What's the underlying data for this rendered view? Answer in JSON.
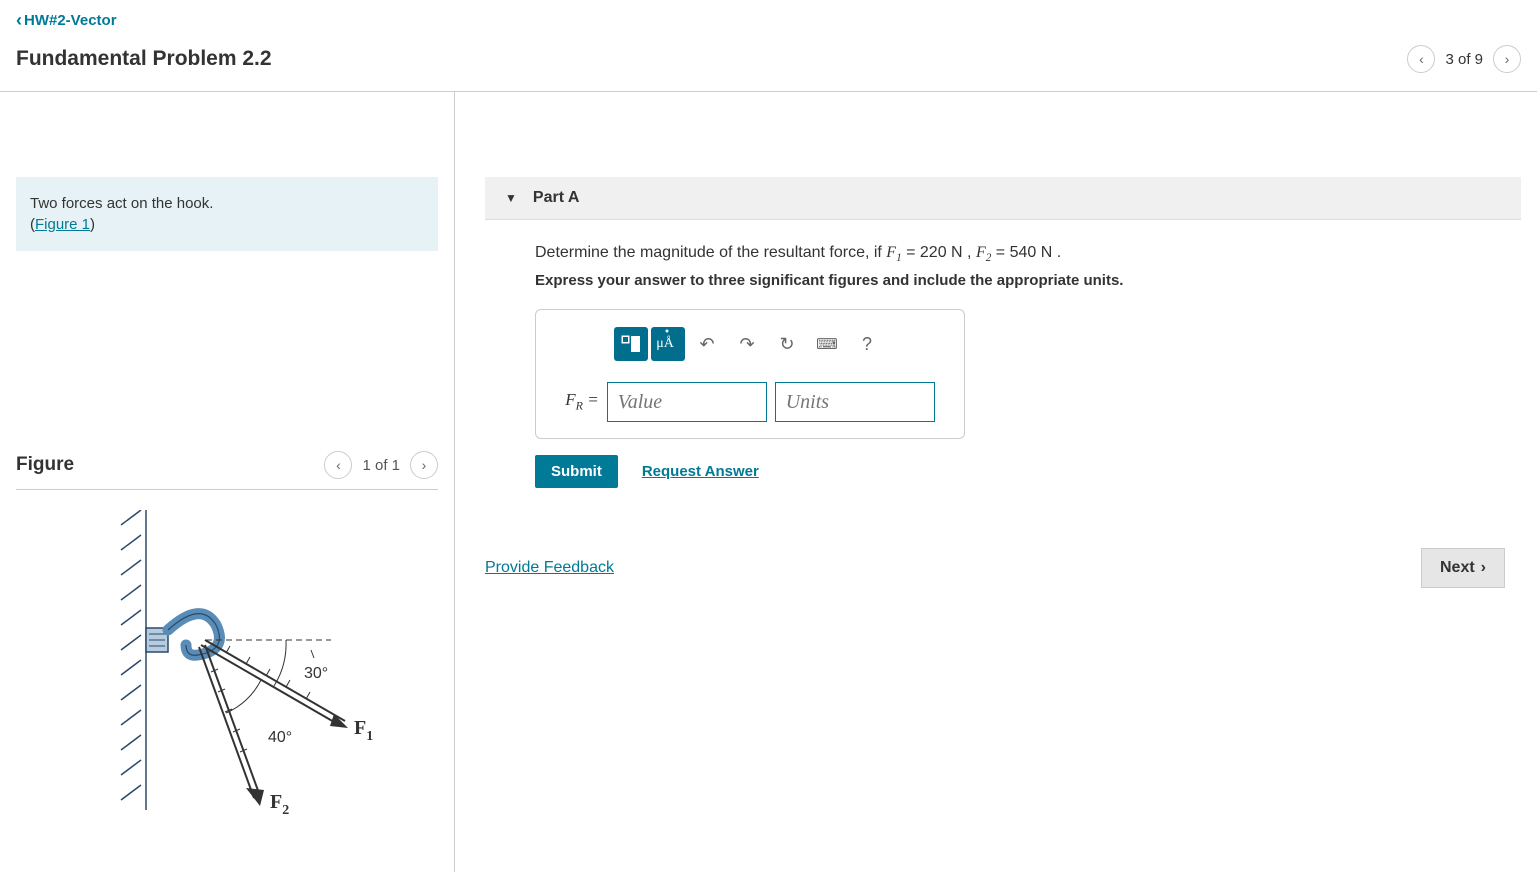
{
  "breadcrumb": "HW#2-Vector",
  "problem_title": "Fundamental Problem 2.2",
  "nav": {
    "counter": "3 of 9"
  },
  "intro": {
    "line1": "Two forces act on the hook.",
    "figure_link": "Figure 1"
  },
  "figure": {
    "title": "Figure",
    "counter": "1 of 1",
    "angle1": "30°",
    "angle2": "40°",
    "f1": "F",
    "f1_sub": "1",
    "f2": "F",
    "f2_sub": "2"
  },
  "part": {
    "label": "Part A",
    "question_pre": "Determine the magnitude of the resultant force, if ",
    "f1_sym": "F",
    "f1_sub": "1",
    "f1_val": " = 220 N",
    "sep": " , ",
    "f2_sym": "F",
    "f2_sub": "2",
    "f2_val": " = 540 N",
    "question_post": " .",
    "instruction": "Express your answer to three significant figures and include the appropriate units.",
    "toolbar": {
      "templates": "▭",
      "mu": "μÅ",
      "undo": "↶",
      "redo": "↷",
      "reset": "↻",
      "keyboard": "⌨",
      "help": "?"
    },
    "fr_sym": "F",
    "fr_sub": "R",
    "equals": " = ",
    "value_placeholder": "Value",
    "units_placeholder": "Units",
    "submit": "Submit",
    "request": "Request Answer"
  },
  "footer": {
    "feedback": "Provide Feedback",
    "next": "Next"
  }
}
